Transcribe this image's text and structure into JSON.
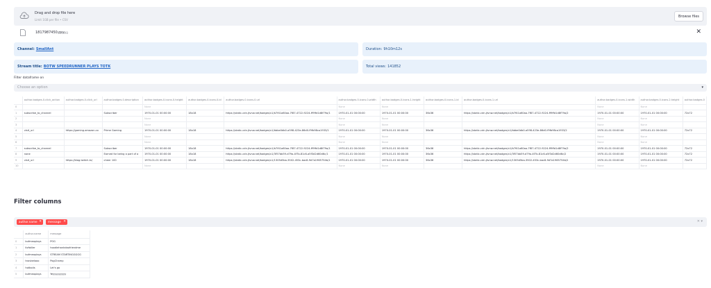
{
  "uploader": {
    "drag_text": "Drag and drop file here",
    "limit_text": "Limit 1GB per file • CSV",
    "browse_label": "Browse files"
  },
  "file": {
    "name": "1817987450.csv",
    "size": "14.1MB"
  },
  "info": {
    "channel_label": "Channel:",
    "channel_value": "SmallAnt",
    "duration_label": "Duration:",
    "duration_value": "9h10m12s",
    "title_label": "Stream title:",
    "title_value": "BOTW SPEEDRUNNER PLAYS TOTK",
    "views_label": "Total views:",
    "views_value": "141852"
  },
  "filter": {
    "label": "Filter dataframe on",
    "placeholder": "Choose an option"
  },
  "table": {
    "columns": [
      "",
      "author.badges.0.click_action",
      "author.badges.0.click_url",
      "author.badges.0.description",
      "author.badges.0.icons.0.height",
      "author.badges.0.icons.0.id",
      "author.badges.0.icons.0.url",
      "author.badges.0.icons.0.width",
      "author.badges.0.icons.1.height",
      "author.badges.0.icons.1.id",
      "author.badges.0.icons.1.url",
      "author.badges.0.icons.1.width",
      "author.badges.0.icons.2.height",
      "author.badges.0"
    ],
    "rows": [
      [
        "0",
        "",
        "",
        "",
        "None",
        "",
        "",
        "None",
        "None",
        "",
        "",
        "None",
        "None",
        ""
      ],
      [
        "1",
        "subscribe_to_channel",
        "",
        "Subscriber",
        "1970-01-01 00:00:00",
        "18x18",
        "https://static-cdn.jtvnw.net/badges/v1/b7f41a60aa-7f87-4722-9224-ff9ffd1d8f79a/1",
        "1970-01-01 00:00:00",
        "1970-01-01 00:00:00",
        "36x36",
        "https://static-cdn.jtvnw.net/badges/v1/b7f41a60aa-7f87-4722-9224-ff9ffd1d8f79a/2",
        "1970-01-01 00:00:00",
        "1970-01-01 00:00:00",
        "72x72"
      ],
      [
        "2",
        "",
        "",
        "",
        "None",
        "",
        "",
        "None",
        "None",
        "",
        "",
        "None",
        "None",
        ""
      ],
      [
        "3",
        "",
        "",
        "",
        "None",
        "",
        "",
        "None",
        "None",
        "",
        "",
        "None",
        "None",
        ""
      ],
      [
        "4",
        "visit_url",
        "https://gaming.amazon.co",
        "Prime Gaming",
        "1970-01-01 00:00:00",
        "18x18",
        "https://static-cdn.jtvnw.net/badges/v1/bbbe0db0-a598-423e-86d0-f9fb98ca1933/1",
        "1970-01-01 00:00:00",
        "1970-01-01 00:00:00",
        "36x36",
        "https://static-cdn.jtvnw.net/badges/v1/bbbe0db0-a598-423e-86d0-f9fb98ca1933/2",
        "1970-01-01 00:00:00",
        "1970-01-01 00:00:00",
        "72x72"
      ],
      [
        "5",
        "",
        "",
        "",
        "None",
        "",
        "",
        "None",
        "None",
        "",
        "",
        "None",
        "None",
        ""
      ],
      [
        "6",
        "",
        "",
        "",
        "None",
        "",
        "",
        "None",
        "None",
        "",
        "",
        "None",
        "None",
        ""
      ],
      [
        "7",
        "subscribe_to_channel",
        "",
        "Subscriber",
        "1970-01-01 00:00:00",
        "18x18",
        "https://static-cdn.jtvnw.net/badges/v1/b7f41a60aa-7f87-4722-9224-ff9ffd1d8f79a/1",
        "1970-01-01 00:00:00",
        "1970-01-01 00:00:00",
        "36x36",
        "https://static-cdn.jtvnw.net/badges/v1/b7f41a60aa-7f87-4722-9224-ff9ffd1d8f79a/2",
        "1970-01-01 00:00:00",
        "1970-01-01 00:00:00",
        "72x72"
      ],
      [
        "8",
        "none",
        "",
        "Earned for being a part of a",
        "1970-01-01 00:00:00",
        "18x18",
        "https://static-cdn.jtvnw.net/badges/v1/3f57bb59-d79a-4f7b-81c6-a5f3d2d60d6c/1",
        "1970-01-01 00:00:00",
        "1970-01-01 00:00:00",
        "36x36",
        "https://static-cdn.jtvnw.net/badges/v1/3f57bb59-d79a-4f7b-81c6-a5f3d2d60d6c/2",
        "1970-01-01 00:00:00",
        "1970-01-01 00:00:00",
        "72x72"
      ],
      [
        "9",
        "visit_url",
        "https://blog.twitch.tv/",
        "cheer 100",
        "1970-01-01 00:00:00",
        "18x18",
        "https://static-cdn.jtvnw.net/badges/v1/1305d5ba-3502-453c-bac8-9d7a1965754b/1",
        "1970-01-01 00:00:00",
        "1970-01-01 00:00:00",
        "36x36",
        "https://static-cdn.jtvnw.net/badges/v1/1305d5ba-3502-453c-bac8-9d7a1965754b/2",
        "1970-01-01 00:00:00",
        "1970-01-01 00:00:00",
        "72x72"
      ],
      [
        "10",
        "",
        "",
        "",
        "None",
        "",
        "",
        "None",
        "None",
        "",
        "",
        "None",
        "None",
        ""
      ]
    ]
  },
  "filter_columns": {
    "heading": "Filter columns",
    "tags": [
      "author.name",
      "message"
    ]
  },
  "table2": {
    "columns": [
      "",
      "author.name",
      "message"
    ],
    "rows": [
      [
        "0",
        "bufmeoplays",
        "POG"
      ],
      [
        "1",
        "itzfaiiler",
        "hoodiehankdaofriendme"
      ],
      [
        "2",
        "bufmeoplays",
        "STREAM STARTINGGGGG"
      ],
      [
        "3",
        "tnovbelooo",
        "PogChamp"
      ],
      [
        "4",
        "hotboiis",
        "Let's go"
      ],
      [
        "5",
        "bufmeoplays",
        "Yeyyyyyyyyy"
      ]
    ]
  }
}
